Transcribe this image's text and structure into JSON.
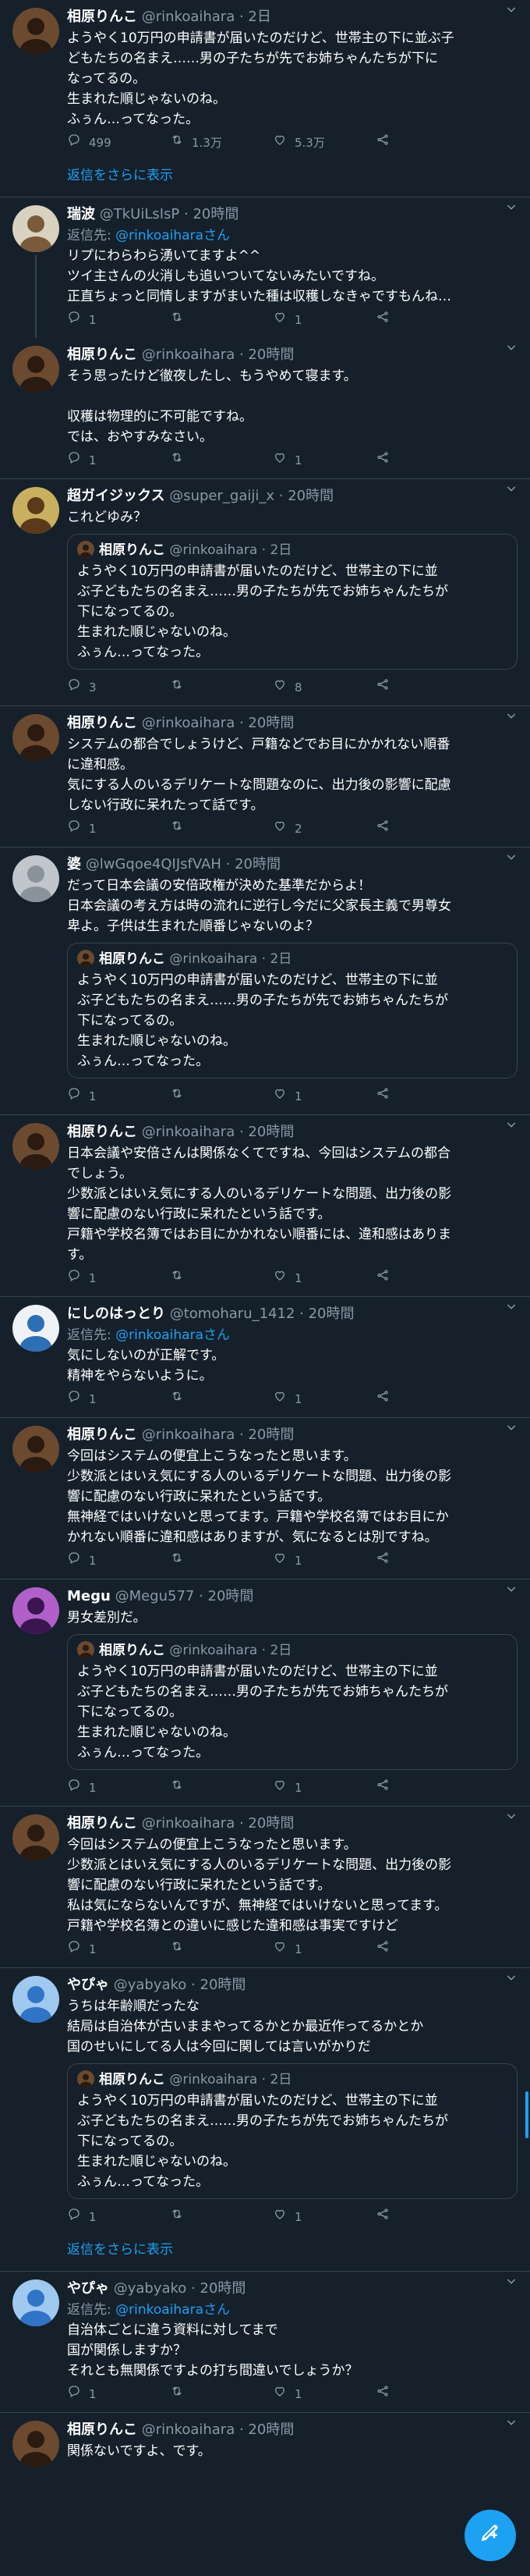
{
  "tweets": [
    {
      "name": "相原りんこ",
      "handle": "@rinkoaihara",
      "time": "2日",
      "lines": [
        "ようやく10万円の申請書が届いたのだけど、世帯主の下に並ぶ子",
        "どもたちの名まえ……男の子たちが先でお姉ちゃんたちが下に",
        "なってるの。",
        "生まれた順じゃないのね。",
        "ふぅん…ってなった。"
      ],
      "counts": {
        "reply": "499",
        "retweet": "1.3万",
        "like": "5.3万"
      }
    },
    {
      "name": "瑞波",
      "handle": "@TkUiLsIsP",
      "time": "20時間",
      "reply_to_label": "返信先:",
      "reply_to_handle": "@rinkoaiharaさん",
      "lines": [
        "リプにわらわら湧いてますよ^^",
        "ツイ主さんの火消しも追いついてないみたいですね。",
        "正直ちょっと同情しますがまいた種は収穫しなきゃですもんね…"
      ],
      "counts": {
        "reply": "1",
        "retweet": "",
        "like": "1"
      }
    },
    {
      "name": "相原りんこ",
      "handle": "@rinkoaihara",
      "time": "20時間",
      "lines": [
        "そう思ったけど徹夜したし、もうやめて寝ます。",
        "",
        "収穫は物理的に不可能ですね。",
        "では、おやすみなさい。"
      ],
      "counts": {
        "reply": "1",
        "retweet": "",
        "like": "1"
      }
    },
    {
      "name": "超ガイジックス",
      "handle": "@super_gaiji_x",
      "time": "20時間",
      "lines": [
        "これどゆみ？"
      ],
      "quote": {
        "name": "相原りんこ",
        "handle": "@rinkoaihara",
        "time": "2日",
        "lines": [
          "ようやく10万円の申請書が届いたのだけど、世帯主の下に並",
          "ぶ子どもたちの名まえ……男の子たちが先でお姉ちゃんたちが",
          "下になってるの。",
          "生まれた順じゃないのね。",
          "ふぅん…ってなった。"
        ]
      },
      "counts": {
        "reply": "3",
        "retweet": "",
        "like": "8"
      }
    },
    {
      "name": "相原りんこ",
      "handle": "@rinkoaihara",
      "time": "20時間",
      "lines": [
        "システムの都合でしょうけど、戸籍などでお目にかかれない順番",
        "に違和感。",
        "気にする人のいるデリケートな問題なのに、出力後の影響に配慮",
        "しない行政に呆れたって話です。"
      ],
      "counts": {
        "reply": "1",
        "retweet": "",
        "like": "2"
      }
    },
    {
      "name": "婆",
      "handle": "@lwGqoe4QIJsfVAH",
      "time": "20時間",
      "lines": [
        "だって日本会議の安倍政権が決めた基準だからよ！",
        "日本会議の考え方は時の流れに逆行し今だに父家長主義で男尊女",
        "卑よ。子供は生まれた順番じゃないのよ？"
      ],
      "quote": {
        "name": "相原りんこ",
        "handle": "@rinkoaihara",
        "time": "2日",
        "lines": [
          "ようやく10万円の申請書が届いたのだけど、世帯主の下に並",
          "ぶ子どもたちの名まえ……男の子たちが先でお姉ちゃんたちが",
          "下になってるの。",
          "生まれた順じゃないのね。",
          "ふぅん…ってなった。"
        ]
      },
      "counts": {
        "reply": "1",
        "retweet": "",
        "like": "1"
      }
    },
    {
      "name": "相原りんこ",
      "handle": "@rinkoaihara",
      "time": "20時間",
      "lines": [
        "日本会議や安倍さんは関係なくてですね、今回はシステムの都合",
        "でしょう。",
        "少数派とはいえ気にする人のいるデリケートな問題、出力後の影",
        "響に配慮のない行政に呆れたという話です。",
        "戸籍や学校名簿ではお目にかかれない順番には、違和感はありま",
        "す。"
      ],
      "counts": {
        "reply": "1",
        "retweet": "",
        "like": "1"
      }
    },
    {
      "name": "にしのはっとり",
      "handle": "@tomoharu_1412",
      "time": "20時間",
      "reply_to_label": "返信先:",
      "reply_to_handle": "@rinkoaiharaさん",
      "lines": [
        "気にしないのが正解です。",
        "精神をやらないように。"
      ],
      "counts": {
        "reply": "1",
        "retweet": "",
        "like": "1"
      }
    },
    {
      "name": "相原りんこ",
      "handle": "@rinkoaihara",
      "time": "20時間",
      "lines": [
        "今回はシステムの便宜上こうなったと思います。",
        "少数派とはいえ気にする人のいるデリケートな問題、出力後の影",
        "響に配慮のない行政に呆れたという話です。",
        "無神経ではいけないと思ってます。戸籍や学校名簿ではお目にか",
        "かれない順番に違和感はありますが、気になるとは別ですね。"
      ],
      "counts": {
        "reply": "1",
        "retweet": "",
        "like": "1"
      }
    },
    {
      "name": "Megu",
      "handle": "@Megu577",
      "time": "20時間",
      "lines": [
        "男女差別だ。"
      ],
      "quote": {
        "name": "相原りんこ",
        "handle": "@rinkoaihara",
        "time": "2日",
        "lines": [
          "ようやく10万円の申請書が届いたのだけど、世帯主の下に並",
          "ぶ子どもたちの名まえ……男の子たちが先でお姉ちゃんたちが",
          "下になってるの。",
          "生まれた順じゃないのね。",
          "ふぅん…ってなった。"
        ]
      },
      "counts": {
        "reply": "1",
        "retweet": "",
        "like": "1"
      }
    },
    {
      "name": "相原りんこ",
      "handle": "@rinkoaihara",
      "time": "20時間",
      "lines": [
        "今回はシステムの便宜上こうなったと思います。",
        "少数派とはいえ気にする人のいるデリケートな問題、出力後の影",
        "響に配慮のない行政に呆れたという話です。",
        "私は気にならないんですが、無神経ではいけないと思ってます。",
        "戸籍や学校名簿との違いに感じた違和感は事実ですけど"
      ],
      "counts": {
        "reply": "1",
        "retweet": "",
        "like": "1"
      }
    },
    {
      "name": "やぴゃ",
      "handle": "@yabyako",
      "time": "20時間",
      "lines": [
        "うちは年齢順だったな",
        "結局は自治体が古いままやってるかとか最近作ってるかとか",
        "国のせいにしてる人は今回に関しては言いがかりだ"
      ],
      "quote": {
        "name": "相原りんこ",
        "handle": "@rinkoaihara",
        "time": "2日",
        "lines": [
          "ようやく10万円の申請書が届いたのだけど、世帯主の下に並",
          "ぶ子どもたちの名まえ……男の子たちが先でお姉ちゃんたちが",
          "下になってるの。",
          "生まれた順じゃないのね。",
          "ふぅん…ってなった。"
        ]
      },
      "counts": {
        "reply": "1",
        "retweet": "",
        "like": "1"
      }
    },
    {
      "name": "やぴゃ",
      "handle": "@yabyako",
      "time": "20時間",
      "reply_to_label": "返信先:",
      "reply_to_handle": "@rinkoaiharaさん",
      "lines": [
        "自治体ごとに違う資料に対してまで",
        "国が関係しますか？",
        "それとも無関係ですよの打ち間違いでしょうか？"
      ],
      "counts": {
        "reply": "1",
        "retweet": "",
        "like": "1"
      }
    },
    {
      "name": "相原りんこ",
      "handle": "@rinkoaihara",
      "time": "20時間",
      "lines": [
        "関係ないですよ、です。"
      ]
    }
  ],
  "show_more_label": "返信をさらに表示",
  "icons": {
    "reply": "reply-icon",
    "retweet": "retweet-icon",
    "like": "like-icon",
    "share": "share-icon",
    "more": "chevron-down-icon",
    "compose": "compose-tweet-icon"
  },
  "colors": {
    "background": "#15202b",
    "divider": "#38444d",
    "secondary_text": "#8899a6",
    "accent": "#1da1f2"
  }
}
